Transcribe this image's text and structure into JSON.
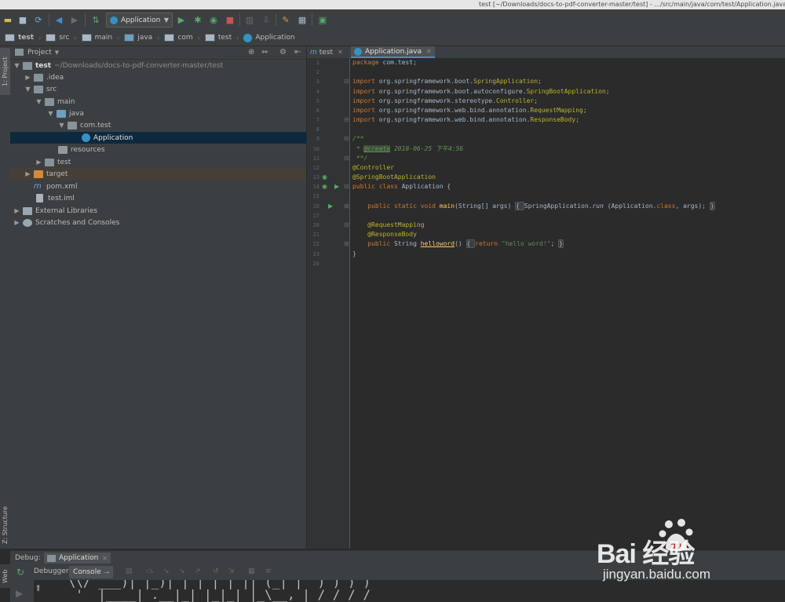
{
  "title_bar": {
    "text": "test [~/Downloads/docs-to-pdf-converter-master/test] - .../src/main/java/com/test/Application.java"
  },
  "toolbar": {
    "run_config": "Application"
  },
  "breadcrumbs": [
    "test",
    "src",
    "main",
    "java",
    "com",
    "test",
    "Application"
  ],
  "left_strip": {
    "project_tab": "1: Project",
    "structure_tab": "Z: Structure",
    "web_tab": "Web"
  },
  "project_panel": {
    "title": "Project",
    "tree": [
      {
        "label": "test",
        "path": "~/Downloads/docs-to-pdf-converter-master/test"
      },
      {
        "label": ".idea"
      },
      {
        "label": "src"
      },
      {
        "label": "main"
      },
      {
        "label": "java"
      },
      {
        "label": "com.test"
      },
      {
        "label": "Application"
      },
      {
        "label": "resources"
      },
      {
        "label": "test"
      },
      {
        "label": "target"
      },
      {
        "label": "pom.xml"
      },
      {
        "label": "test.iml"
      },
      {
        "label": "External Libraries"
      },
      {
        "label": "Scratches and Consoles"
      }
    ]
  },
  "editor": {
    "tabs": [
      {
        "label": "test"
      },
      {
        "label": "Application.java"
      }
    ],
    "line_numbers": [
      "1",
      "2",
      "3",
      "4",
      "5",
      "6",
      "7",
      "8",
      "9",
      "10",
      "11",
      "12",
      "13",
      "14",
      "15",
      "16",
      "17",
      "20",
      "21",
      "22",
      "23",
      "26"
    ],
    "code": {
      "l1_kw": "package",
      "l1_rest": " com.test;",
      "import_kw": "import",
      "l3_pkg": " org.springframework.boot.",
      "l3_cls": "SpringApplication",
      "l3_end": ";",
      "l4_pkg": " org.springframework.boot.autoconfigure.",
      "l4_cls": "SpringBootApplication",
      "l4_end": ";",
      "l5_pkg": " org.springframework.stereotype.",
      "l5_cls": "Controller",
      "l5_end": ";",
      "l6_pkg": " org.springframework.web.bind.annotation.",
      "l6_cls": "RequestMapping",
      "l6_end": ";",
      "l7_pkg": " org.springframework.web.bind.annotation.",
      "l7_cls": "ResponseBody",
      "l7_end": ";",
      "l9": "/**",
      "l10_star": " * ",
      "l10_tag": "@create",
      "l10_rest": " 2018-06-25 下午4:56",
      "l11": " **/",
      "l12": "@Controller",
      "l13": "@SpringBootApplication",
      "l14_kw": "public class",
      "l14_rest": " Application {",
      "l16_kw": "    public static void",
      "l16_fn": " main",
      "l16_args": "(String[] args) ",
      "l16_open": "{ ",
      "l16_body1": "SpringApplication.",
      "l16_run": "run",
      "l16_body2": " (Application.",
      "l16_class": "class",
      "l16_body3": ", args); ",
      "l16_close": "}",
      "l20": "    @RequestMapping",
      "l21": "    @ResponseBody",
      "l22_kw": "    public",
      "l22_type": " String ",
      "l22_fn": "helloword",
      "l22_paren": "() ",
      "l22_open": "{ ",
      "l22_ret": "return",
      "l22_str": " \"hello word!\"",
      "l22_semi": "; ",
      "l22_close": "}",
      "l23": "}"
    }
  },
  "debug": {
    "label": "Debug:",
    "session_tab": "Application",
    "tabs": {
      "debugger": "Debugger",
      "console": "Console"
    },
    "console_lines": [
      " \\\\/ ___)| |_)| | | | | || (_| |  ) ) ) )",
      "  '  |____| .__|_| |_|_| |_\\__, | / / / /"
    ]
  },
  "watermark": {
    "logo": "Bai  经验",
    "url": "jingyan.baidu.com"
  }
}
